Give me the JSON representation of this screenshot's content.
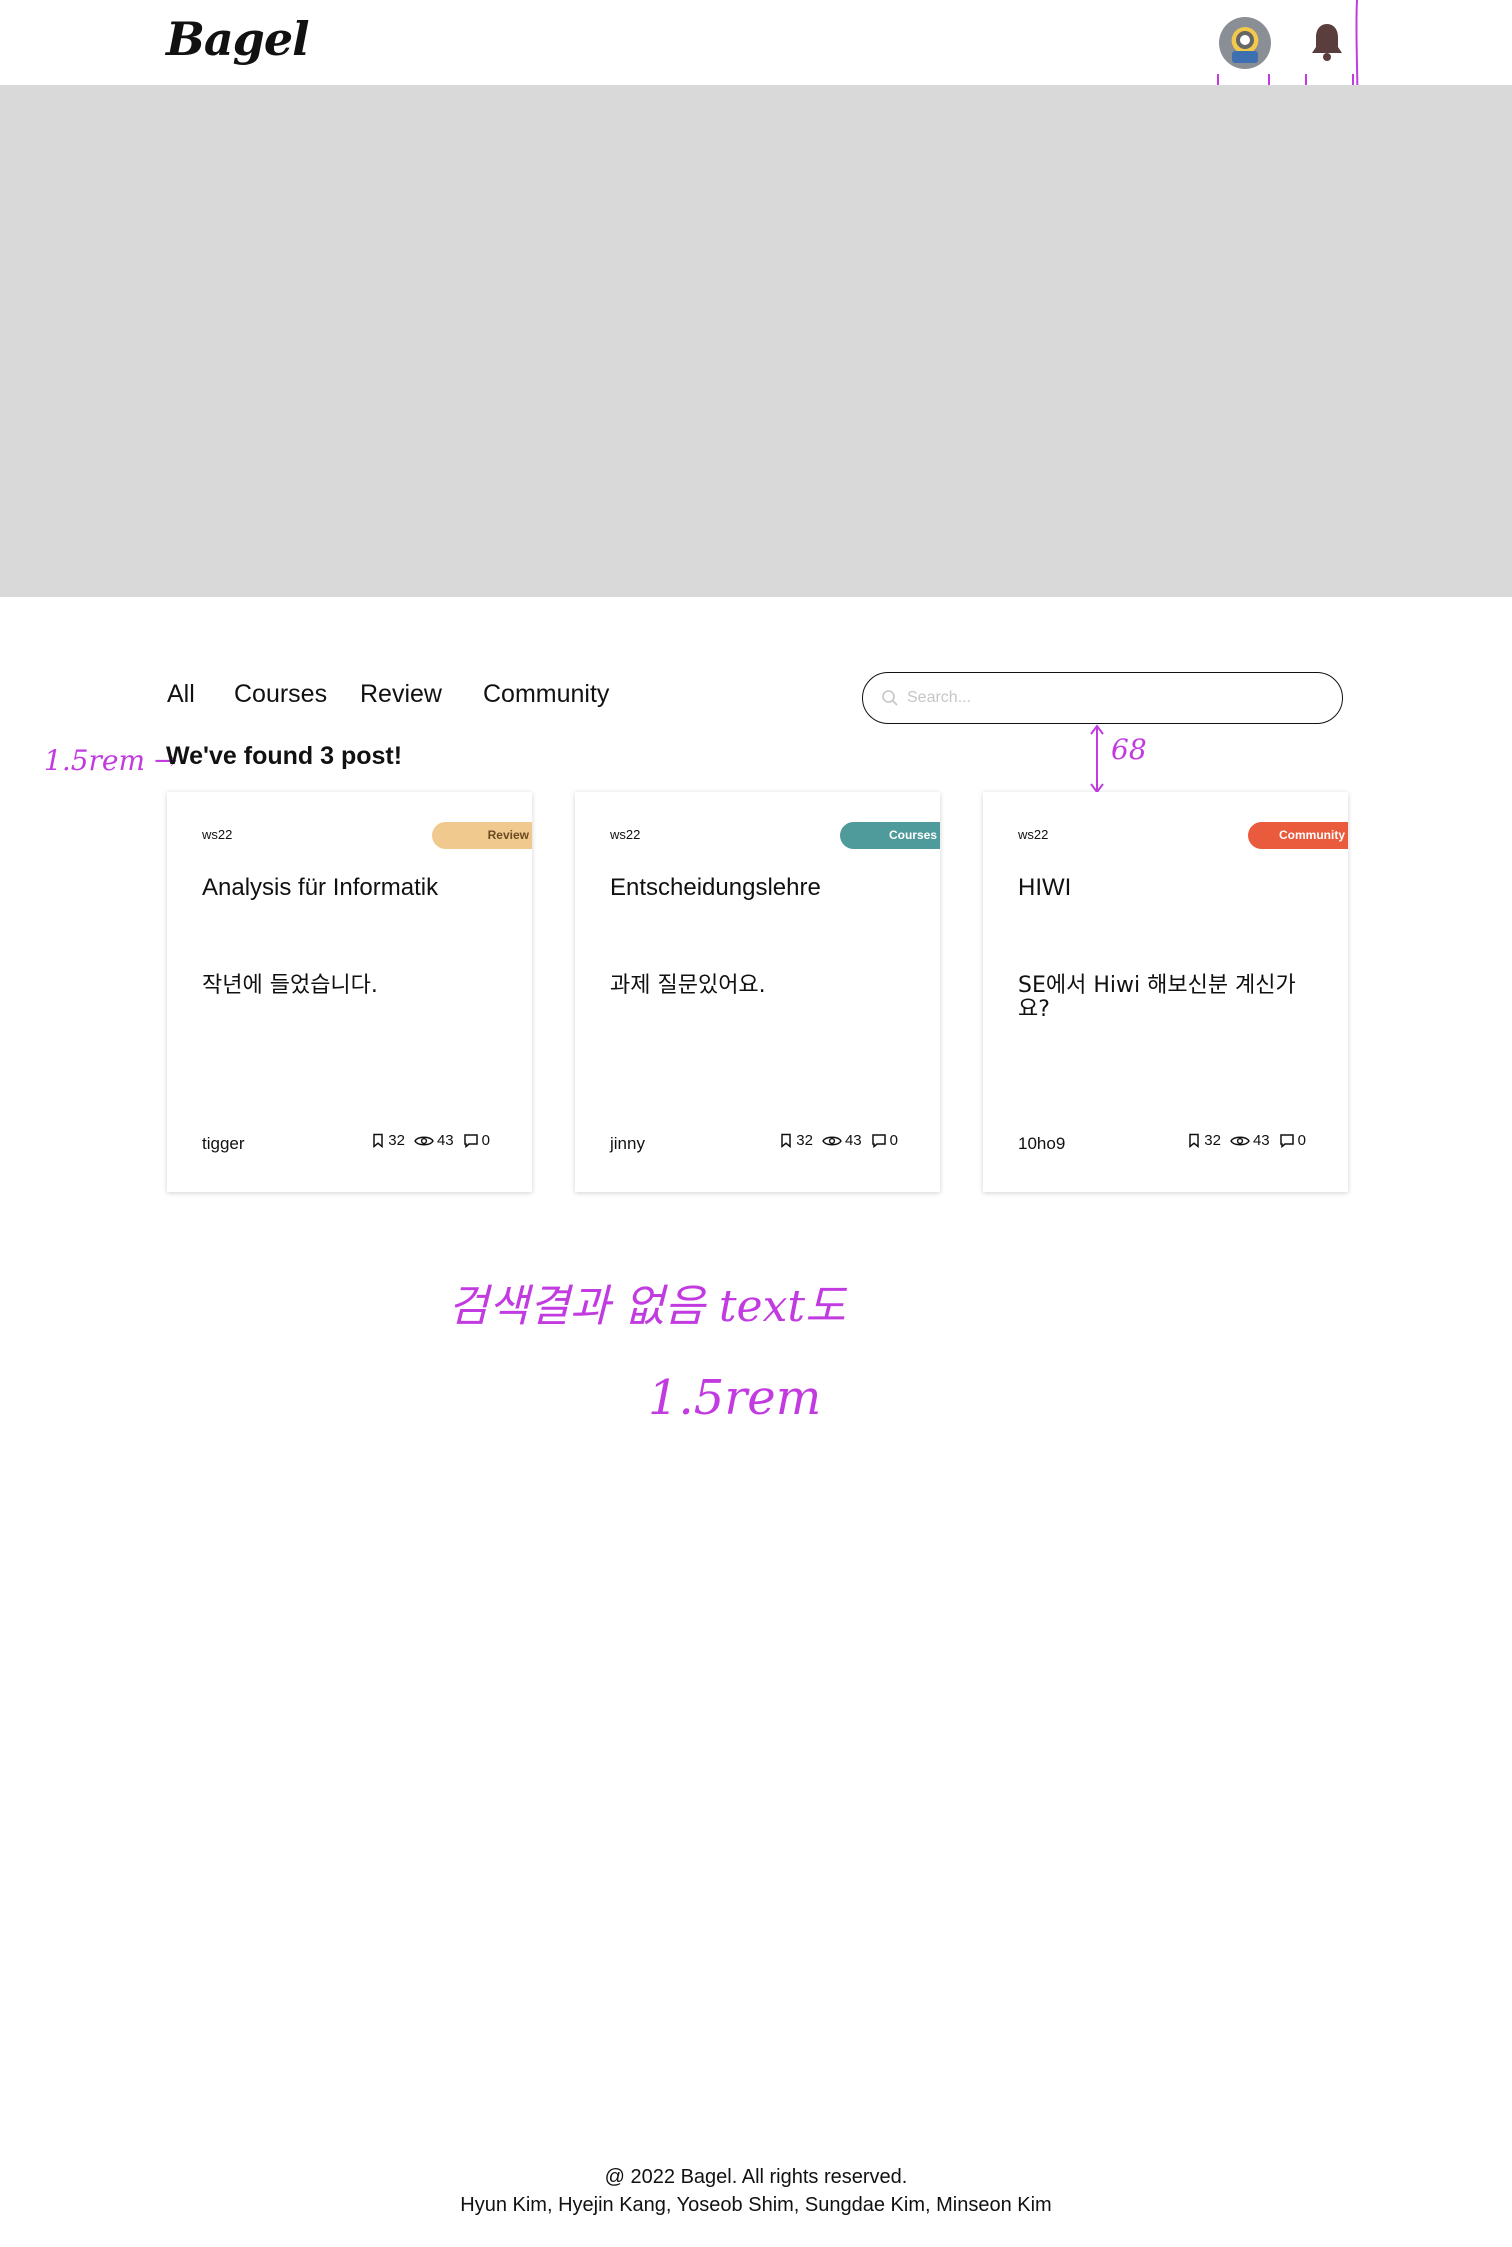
{
  "header": {
    "logo": "Bagel",
    "avatar_icon": "minion-avatar",
    "notification_icon": "bell-icon"
  },
  "annotations": {
    "avatar_width": "50",
    "bell_width": "50",
    "gap": "68",
    "found_size": "1.5rem →",
    "empty_note": "검색결과 없음 text도",
    "empty_size": "1.5rem"
  },
  "filters": [
    "All",
    "Courses",
    "Review",
    "Community"
  ],
  "search": {
    "placeholder": "Search..."
  },
  "results_text": "We've found 3 post!",
  "posts": [
    {
      "term": "ws22",
      "category": "Review",
      "category_color": "#f0c98f",
      "category_text_color": "#6b4a21",
      "title": "Analysis für Informatik",
      "body": "작년에 들었습니다.",
      "author": "tigger",
      "bookmarks": "32",
      "views": "43",
      "comments": "0"
    },
    {
      "term": "ws22",
      "category": "Courses",
      "category_color": "#4f9a9a",
      "category_text_color": "#ffffff",
      "title": "Entscheidungslehre",
      "body": "과제 질문있어요.",
      "author": "jinny",
      "bookmarks": "32",
      "views": "43",
      "comments": "0"
    },
    {
      "term": "ws22",
      "category": "Community",
      "category_color": "#ea5a3c",
      "category_text_color": "#ffffff",
      "title": "HIWI",
      "body": "SE에서 Hiwi 해보신분 계신가요?",
      "author": "10ho9",
      "bookmarks": "32",
      "views": "43",
      "comments": "0"
    }
  ],
  "footer": {
    "copyright": "@ 2022 Bagel. All rights reserved.",
    "credits": "Hyun Kim, Hyejin Kang, Yoseob Shim, Sungdae Kim, Minseon Kim"
  }
}
